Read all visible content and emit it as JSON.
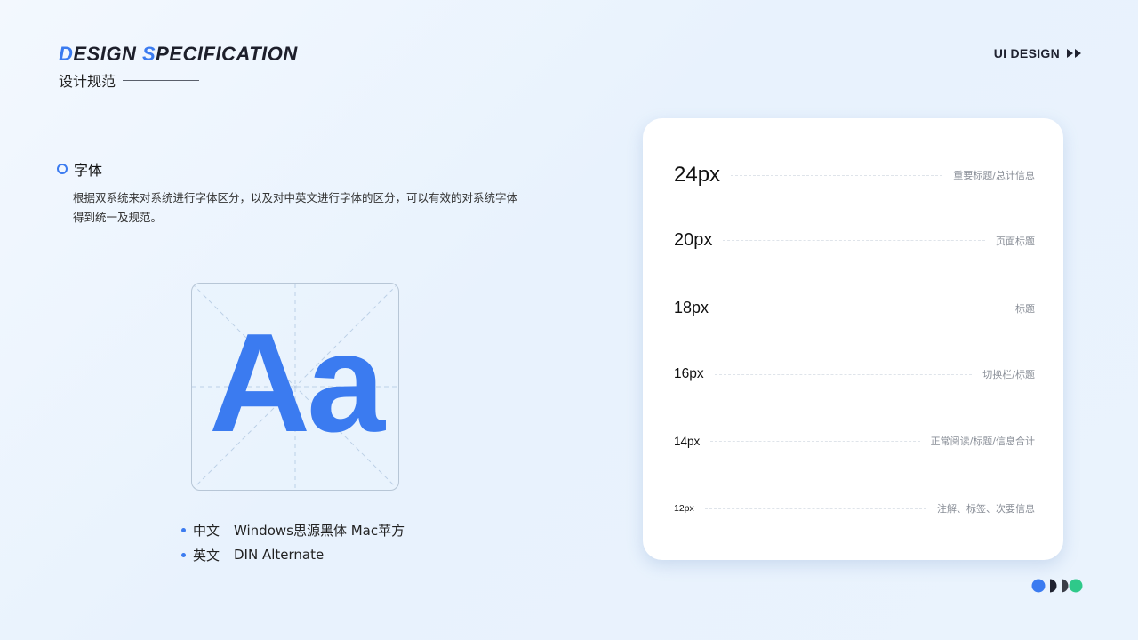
{
  "header": {
    "brand_en_first_letter": "D",
    "brand_en_word1_rest": "ESIGN ",
    "brand_en_second_letter": "S",
    "brand_en_word2_rest": "PECIFICATION",
    "brand_cn": "设计规范",
    "top_right_label": "UI DESIGN"
  },
  "section": {
    "title": "字体",
    "description": "根据双系统来对系统进行字体区分，以及对中英文进行字体的区分，可以有效的对系统字体得到统一及规范。"
  },
  "sample": {
    "glyph": "Aa"
  },
  "fonts": [
    {
      "lang": "中文",
      "value": "Windows思源黑体 Mac苹方"
    },
    {
      "lang": "英文",
      "value": "DIN Alternate"
    }
  ],
  "scale": [
    {
      "size": "24px",
      "usage": "重要标题/总计信息"
    },
    {
      "size": "20px",
      "usage": "页面标题"
    },
    {
      "size": "18px",
      "usage": "标题"
    },
    {
      "size": "16px",
      "usage": "切换栏/标题"
    },
    {
      "size": "14px",
      "usage": "正常阅读/标题/信息合计"
    },
    {
      "size": "12px",
      "usage": "注解、标签、次要信息"
    }
  ],
  "colors": {
    "accent": "#3b7bf0",
    "dark": "#1f2230",
    "green": "#2fc98a"
  }
}
